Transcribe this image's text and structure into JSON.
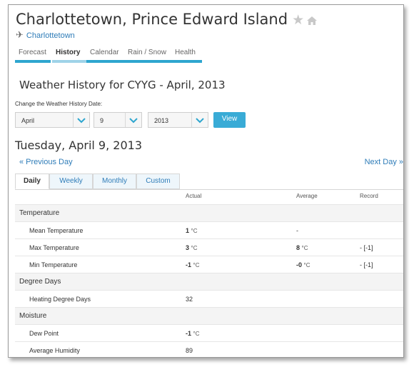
{
  "location": {
    "title": "Charlottetown, Prince Edward Island",
    "station": "Charlottetown"
  },
  "nav_tabs": [
    {
      "label": "Forecast",
      "active": false
    },
    {
      "label": "History",
      "active": true
    },
    {
      "label": "Calendar",
      "active": false
    },
    {
      "label": "Rain / Snow",
      "active": false
    },
    {
      "label": "Health",
      "active": false
    }
  ],
  "history": {
    "heading": "Weather History for CYYG - April, 2013",
    "change_label": "Change the Weather History Date:",
    "month": "April",
    "day": "9",
    "year": "2013",
    "view_label": "View"
  },
  "day": {
    "heading": "Tuesday, April 9, 2013",
    "prev": "« Previous Day",
    "next": "Next Day »"
  },
  "subtabs": [
    {
      "label": "Daily",
      "active": true
    },
    {
      "label": "Weekly",
      "active": false
    },
    {
      "label": "Monthly",
      "active": false
    },
    {
      "label": "Custom",
      "active": false
    }
  ],
  "columns": {
    "actual": "Actual",
    "average": "Average",
    "record": "Record"
  },
  "sections": {
    "temperature": "Temperature",
    "degree_days": "Degree Days",
    "moisture": "Moisture"
  },
  "rows": {
    "mean_temp": {
      "label": "Mean Temperature",
      "actual": "1",
      "actual_unit": "°C",
      "average": "-",
      "record": ""
    },
    "max_temp": {
      "label": "Max Temperature",
      "actual": "3",
      "actual_unit": "°C",
      "average": "8",
      "average_unit": "°C",
      "record": "- [-1]"
    },
    "min_temp": {
      "label": "Min Temperature",
      "actual": "-1",
      "actual_unit": "°C",
      "average": "-0",
      "average_unit": "°C",
      "record": "- [-1]"
    },
    "heating_dd": {
      "label": "Heating Degree Days",
      "actual": "32"
    },
    "dew_point": {
      "label": "Dew Point",
      "actual": "-1",
      "actual_unit": "°C"
    },
    "avg_humidity": {
      "label": "Average Humidity",
      "actual": "89"
    }
  },
  "colors": {
    "accent": "#2ea6cf",
    "link": "#2e7cb8",
    "button": "#39abd6"
  }
}
